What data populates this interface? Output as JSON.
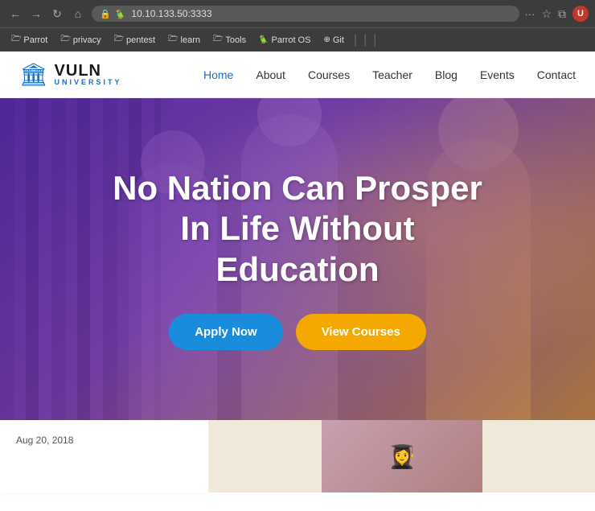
{
  "browser": {
    "url": "10.10.133.50:3333",
    "back_btn": "←",
    "forward_btn": "→",
    "refresh_btn": "↻",
    "home_btn": "⌂",
    "menu_dots": "···",
    "bookmark_icon": "☆",
    "extensions_icon": "⧉",
    "bookmarks": [
      {
        "label": "Parrot",
        "icon": "🗁"
      },
      {
        "label": "privacy",
        "icon": "🗁"
      },
      {
        "label": "pentest",
        "icon": "🗁"
      },
      {
        "label": "learn",
        "icon": "🗁"
      },
      {
        "label": "Tools",
        "icon": "🗁"
      },
      {
        "label": "Parrot OS",
        "icon": "🦜"
      },
      {
        "label": "Git",
        "icon": "⊕"
      },
      {
        "label": "|",
        "icon": ""
      },
      {
        "label": "|",
        "icon": ""
      },
      {
        "label": "|",
        "icon": ""
      }
    ]
  },
  "site": {
    "logo": {
      "name": "VULN",
      "subtitle": "UNIVERSITY",
      "icon": "🏛"
    },
    "nav": {
      "home": "Home",
      "about": "About",
      "courses": "Courses",
      "teacher": "Teacher",
      "blog": "Blog",
      "events": "Events",
      "contact": "Contact"
    },
    "hero": {
      "title_line1": "No Nation Can Prosper",
      "title_line2": "In Life Without",
      "title_line3": "Education",
      "apply_btn": "Apply Now",
      "courses_btn": "View Courses"
    },
    "news": {
      "date": "Aug 20, 2018"
    }
  }
}
